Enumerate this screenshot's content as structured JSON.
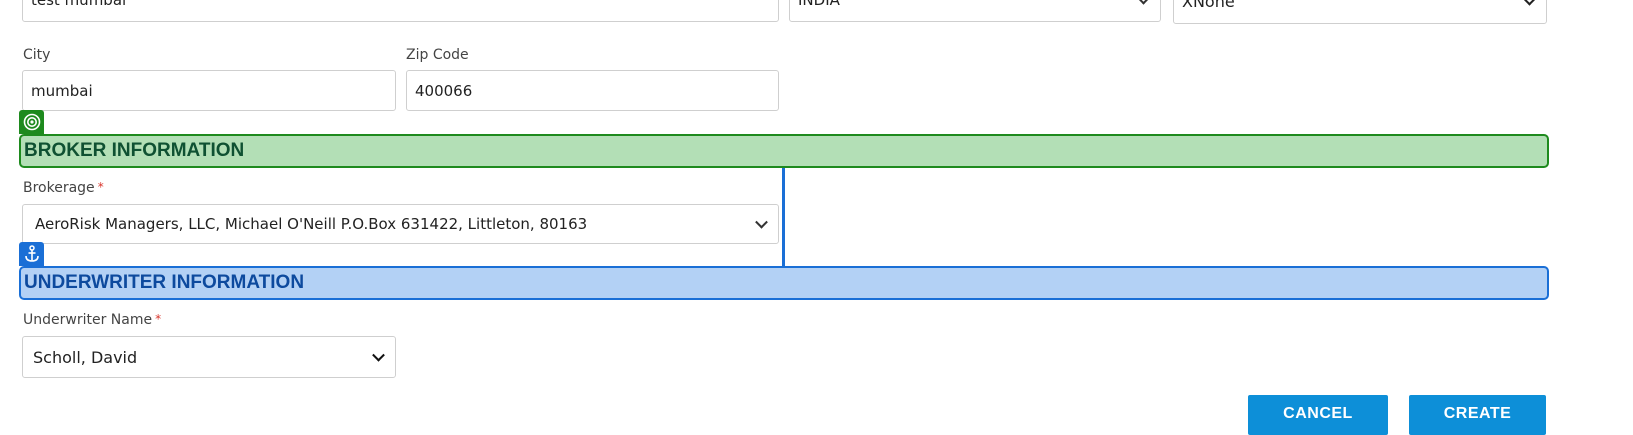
{
  "address": {
    "street_value": "test mumbai",
    "country_value": "INDIA",
    "state_value": "XNone",
    "city_label": "City",
    "city_value": "mumbai",
    "zip_label": "Zip Code",
    "zip_value": "400066"
  },
  "broker": {
    "section_title": "BROKER INFORMATION",
    "brokerage_label": "Brokerage",
    "required_mark": "*",
    "brokerage_value": "AeroRisk Managers, LLC, Michael O'Neill P.O.Box 631422, Littleton, 80163"
  },
  "underwriter": {
    "section_title": "UNDERWRITER INFORMATION",
    "name_label": "Underwriter Name",
    "required_mark": "*",
    "name_value": "Scholl, David"
  },
  "actions": {
    "cancel_label": "CANCEL",
    "create_label": "CREATE"
  },
  "icons": {
    "broker_tag": "target-icon",
    "underwriter_tag": "anchor-icon"
  },
  "colors": {
    "broker_fill": "#b3dfb6",
    "broker_border": "#1e8a1e",
    "broker_text": "#0f5132",
    "underwriter_fill": "#b3d1f5",
    "underwriter_border": "#1a6fd6",
    "underwriter_text": "#0d4a9e",
    "button": "#0d8fd8"
  }
}
